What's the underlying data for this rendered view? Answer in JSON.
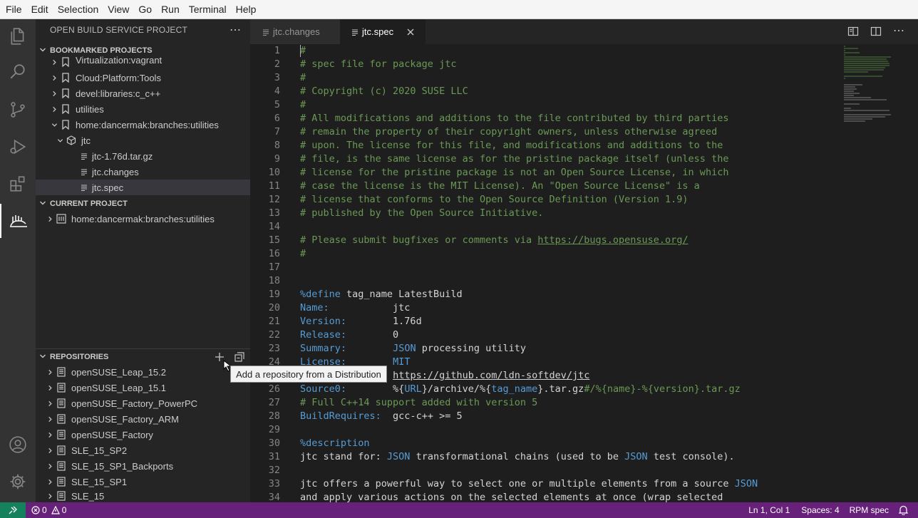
{
  "menubar": [
    "File",
    "Edit",
    "Selection",
    "View",
    "Go",
    "Run",
    "Terminal",
    "Help"
  ],
  "sidebar": {
    "title": "OPEN BUILD SERVICE PROJECT",
    "more_icon": "ellipsis-icon",
    "bookmarked": {
      "header": "BOOKMARKED PROJECTS",
      "items": [
        {
          "label": "Virtualization:vagrant",
          "icon": "bookmark-icon"
        },
        {
          "label": "Cloud:Platform:Tools",
          "icon": "bookmark-icon"
        },
        {
          "label": "devel:libraries:c_c++",
          "icon": "bookmark-icon"
        },
        {
          "label": "utilities",
          "icon": "bookmark-icon"
        },
        {
          "label": "home:dancermak:branches:utilities",
          "icon": "bookmark-icon"
        },
        {
          "label": "jtc",
          "icon": "package-icon"
        },
        {
          "label": "jtc-1.76d.tar.gz",
          "icon": "file-lines-icon"
        },
        {
          "label": "jtc.changes",
          "icon": "file-lines-icon"
        },
        {
          "label": "jtc.spec",
          "icon": "file-lines-icon"
        }
      ]
    },
    "current": {
      "header": "CURRENT PROJECT",
      "items": [
        {
          "label": "home:dancermak:branches:utilities",
          "icon": "project-icon"
        }
      ]
    },
    "repositories": {
      "header": "REPOSITORIES",
      "items": [
        "openSUSE_Leap_15.2",
        "openSUSE_Leap_15.1",
        "openSUSE_Factory_PowerPC",
        "openSUSE_Factory_ARM",
        "openSUSE_Factory",
        "SLE_15_SP2",
        "SLE_15_SP1_Backports",
        "SLE_15_SP1",
        "SLE_15"
      ]
    }
  },
  "tooltip": "Add a repository from a Distribution",
  "tabs": [
    {
      "label": "jtc.changes",
      "active": false
    },
    {
      "label": "jtc.spec",
      "active": true
    }
  ],
  "editor_lines": [
    "#",
    "# spec file for package jtc",
    "#",
    "# Copyright (c) 2020 SUSE LLC",
    "#",
    "# All modifications and additions to the file contributed by third parties",
    "# remain the property of their copyright owners, unless otherwise agreed",
    "# upon. The license for this file, and modifications and additions to the",
    "# file, is the same license as for the pristine package itself (unless the",
    "# license for the pristine package is not an Open Source License, in which",
    "# case the license is the MIT License). An \"Open Source License\" is a",
    "# license that conforms to the Open Source Definition (Version 1.9)",
    "# published by the Open Source Initiative.",
    "",
    "# Please submit bugfixes or comments via https://bugs.opensuse.org/",
    "#",
    "",
    "",
    "%define tag_name LatestBuild",
    "Name:           jtc",
    "Version:        1.76d",
    "Release:        0",
    "Summary:        JSON processing utility",
    "License:        MIT",
    "URL:            https://github.com/ldn-softdev/jtc",
    "Source0:        %{URL}/archive/%{tag_name}.tar.gz#/%{name}-%{version}.tar.gz",
    "# Full C++14 support added with version 5",
    "BuildRequires:  gcc-c++ >= 5",
    "",
    "%description",
    "jtc stand for: JSON transformational chains (used to be JSON test console).",
    "",
    "jtc offers a powerful way to select one or multiple elements from a source JSON",
    "and apply various actions on the selected elements at once (wrap selected"
  ],
  "status": {
    "errors": "0",
    "warnings": "0",
    "position": "Ln 1, Col 1",
    "spaces": "Spaces: 4",
    "language": "RPM spec"
  },
  "colors": {
    "statusbar": "#68217a",
    "comment": "#6a9955",
    "keyword": "#569cd6"
  }
}
